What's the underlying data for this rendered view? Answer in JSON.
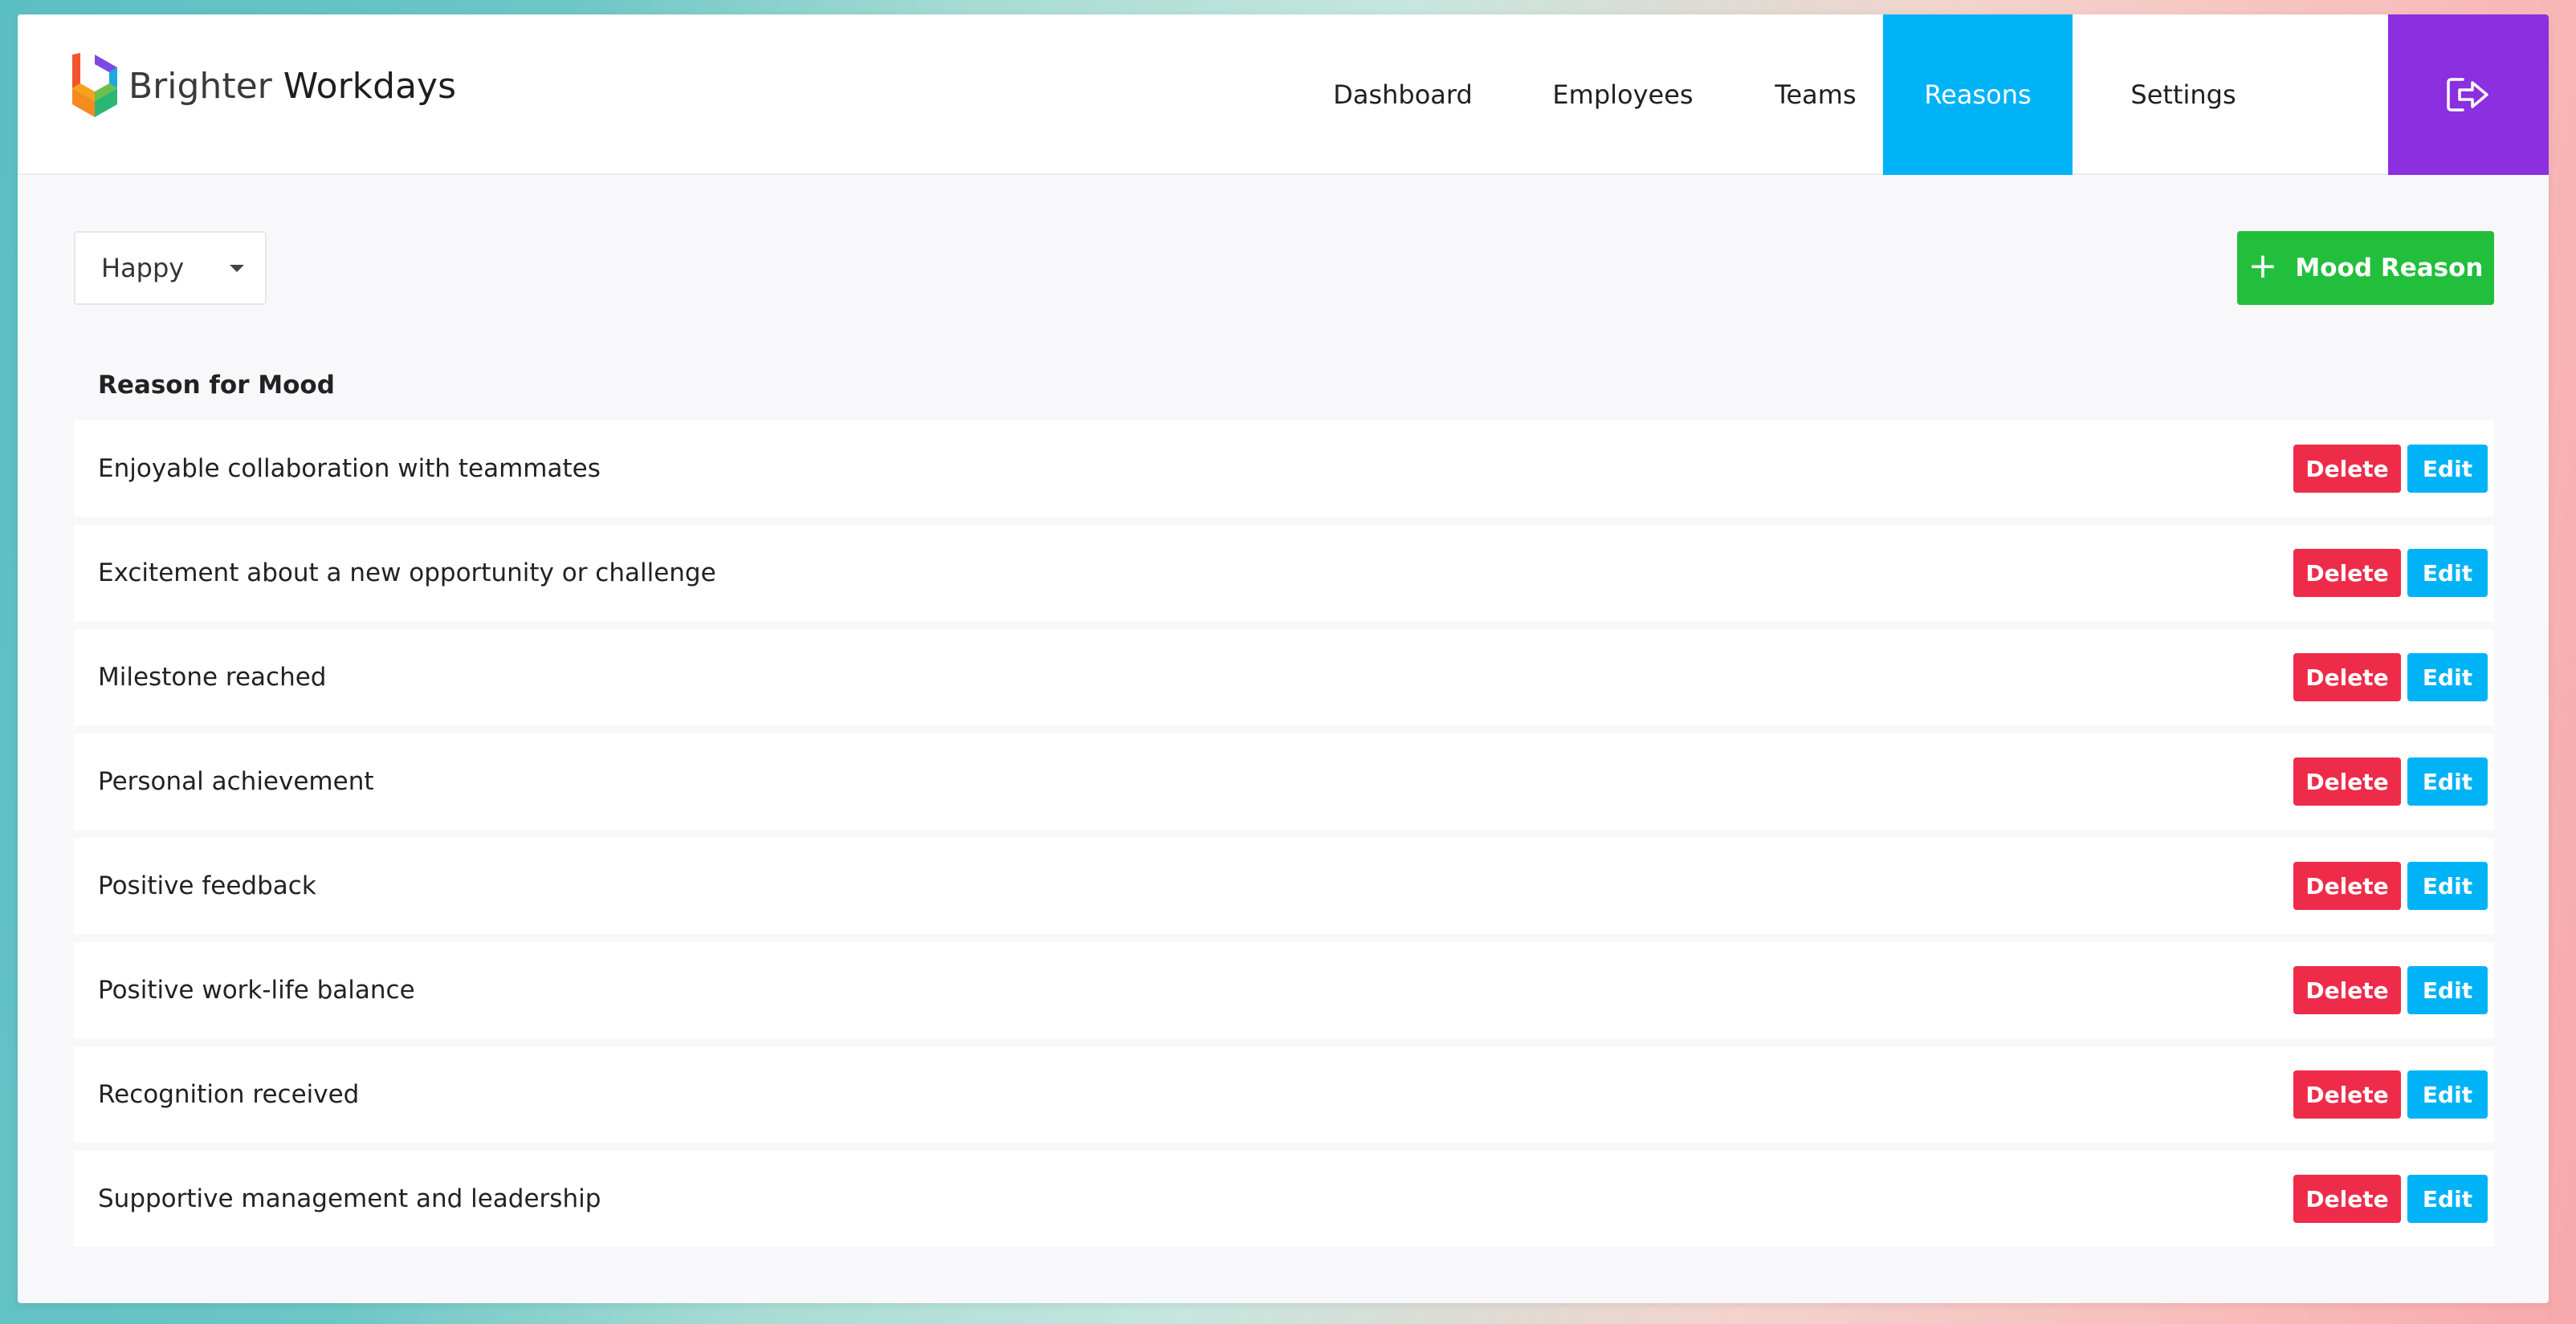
{
  "header": {
    "brand_light": "Brighter",
    "brand_bold": "Workdays",
    "nav": [
      {
        "label": "Dashboard"
      },
      {
        "label": "Employees"
      },
      {
        "label": "Teams"
      },
      {
        "label": "Reasons",
        "active": true
      },
      {
        "label": "Settings"
      }
    ],
    "logout_icon": "logout-icon"
  },
  "toolbar": {
    "mood_select_value": "Happy",
    "add_button_plus": "+",
    "add_button_label": "Mood Reason"
  },
  "table": {
    "column_header": "Reason for Mood",
    "delete_label": "Delete",
    "edit_label": "Edit",
    "rows": [
      "Enjoyable collaboration with teammates",
      "Excitement about a new opportunity or challenge",
      "Milestone reached",
      "Personal achievement",
      "Positive feedback",
      "Positive work-life balance",
      "Recognition received",
      "Supportive management and leadership"
    ]
  },
  "colors": {
    "accent_blue": "#00b3f7",
    "logout_purple": "#8b2fe0",
    "add_green": "#22bf3c",
    "delete_red": "#ee2c4a"
  }
}
